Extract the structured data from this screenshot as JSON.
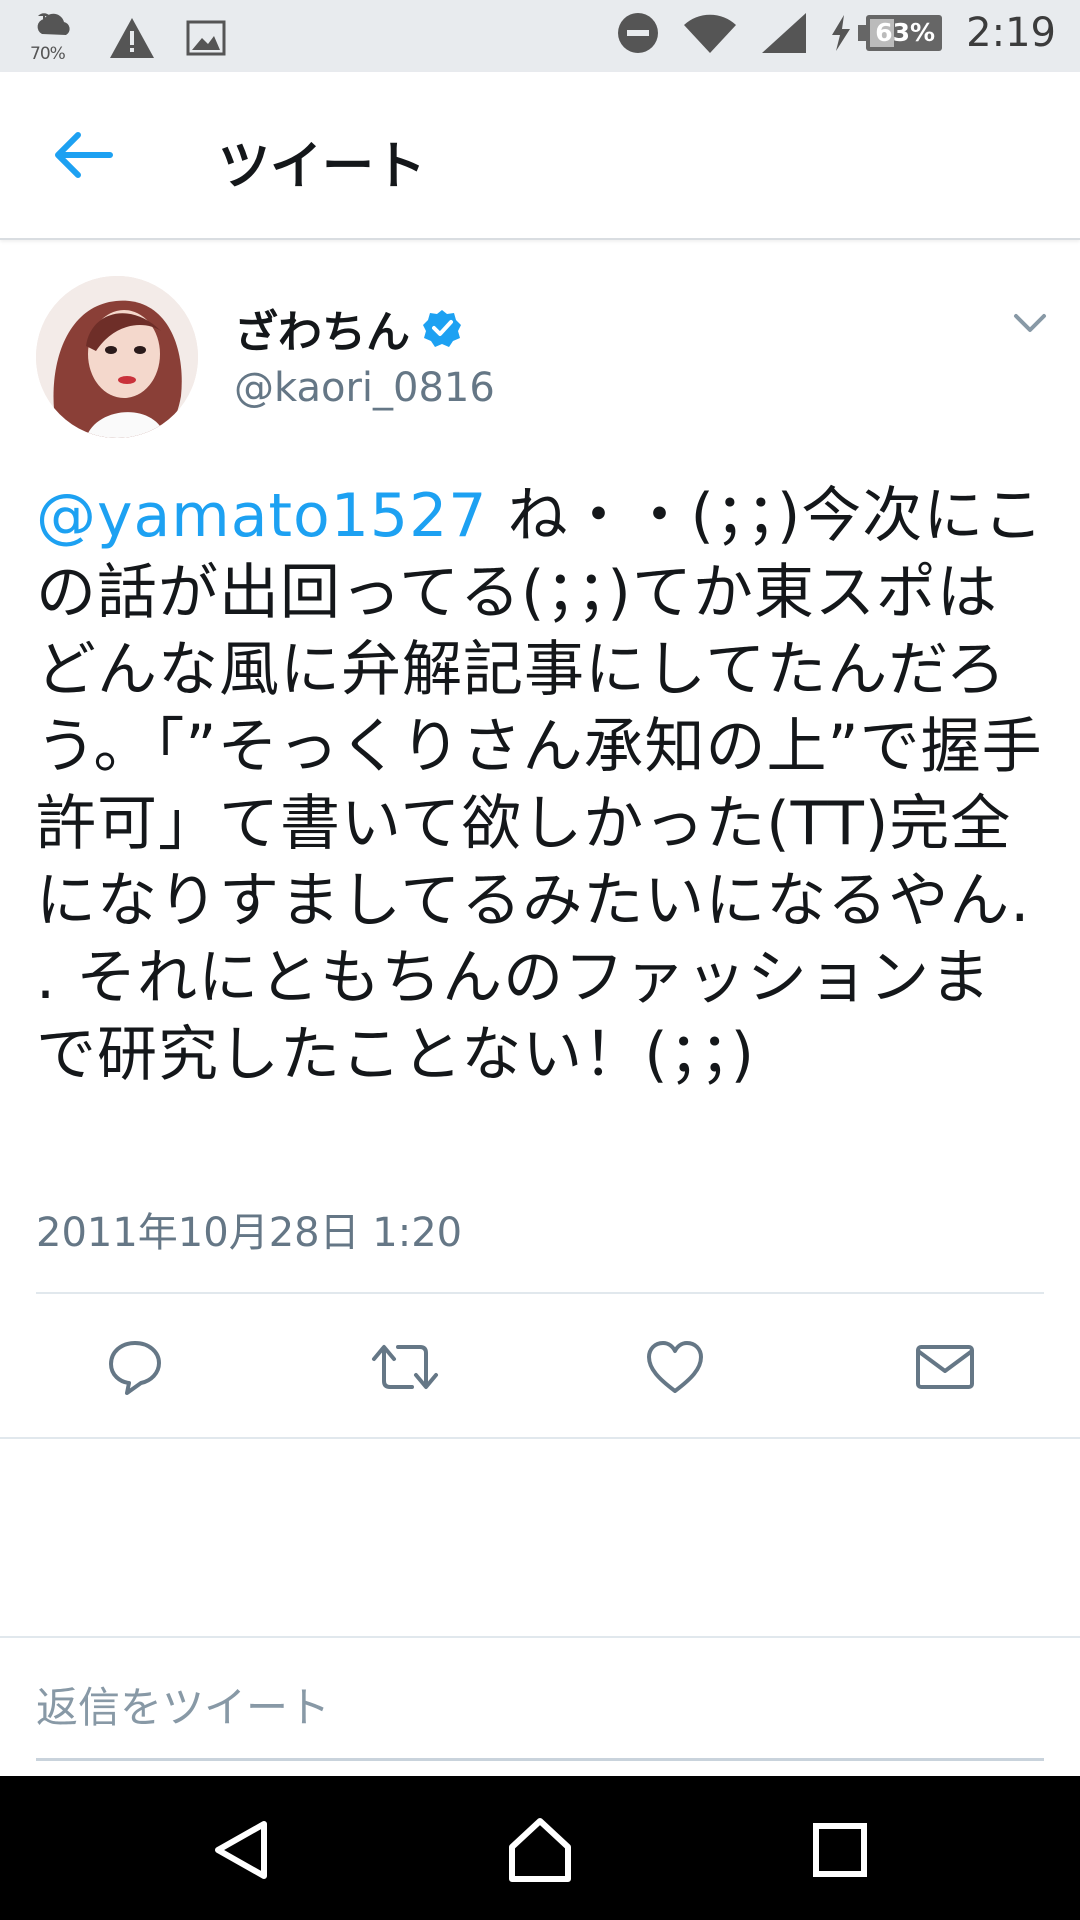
{
  "status_bar": {
    "weather_percent": "70%",
    "battery_percent": "63%",
    "time": "2:19",
    "icons": [
      "weather-icon",
      "warning-icon",
      "image-icon",
      "dnd-icon",
      "wifi-icon",
      "signal-icon",
      "charging-icon",
      "battery-icon"
    ]
  },
  "header": {
    "title": "ツイート",
    "back_icon": "back-arrow-icon"
  },
  "tweet": {
    "author_name": "ざわちん",
    "verified": true,
    "handle": "@kaori_0816",
    "mention": "@yamato1527",
    "body": " ね・・(；；)今次にこの話が出回ってる(；；)てか東スポはどんな風に弁解記事にしてたんだろう。「”そっくりさん承知の上”で握手許可」て書いて欲しかった(TT)完全になりすましてるみたいになるやん. . それにともちんのファッションまで研究したことない！(；；)",
    "date": "2011年10月28日 1:20"
  },
  "actions": [
    "reply-icon",
    "retweet-icon",
    "like-icon",
    "dm-icon"
  ],
  "reply": {
    "placeholder": "返信をツイート"
  },
  "navigation": [
    "back-nav-icon",
    "home-nav-icon",
    "recents-nav-icon"
  ],
  "colors": {
    "accent": "#1da1f2",
    "text": "#14171a",
    "secondary": "#657786",
    "statusbar_bg": "#e8ebee"
  }
}
